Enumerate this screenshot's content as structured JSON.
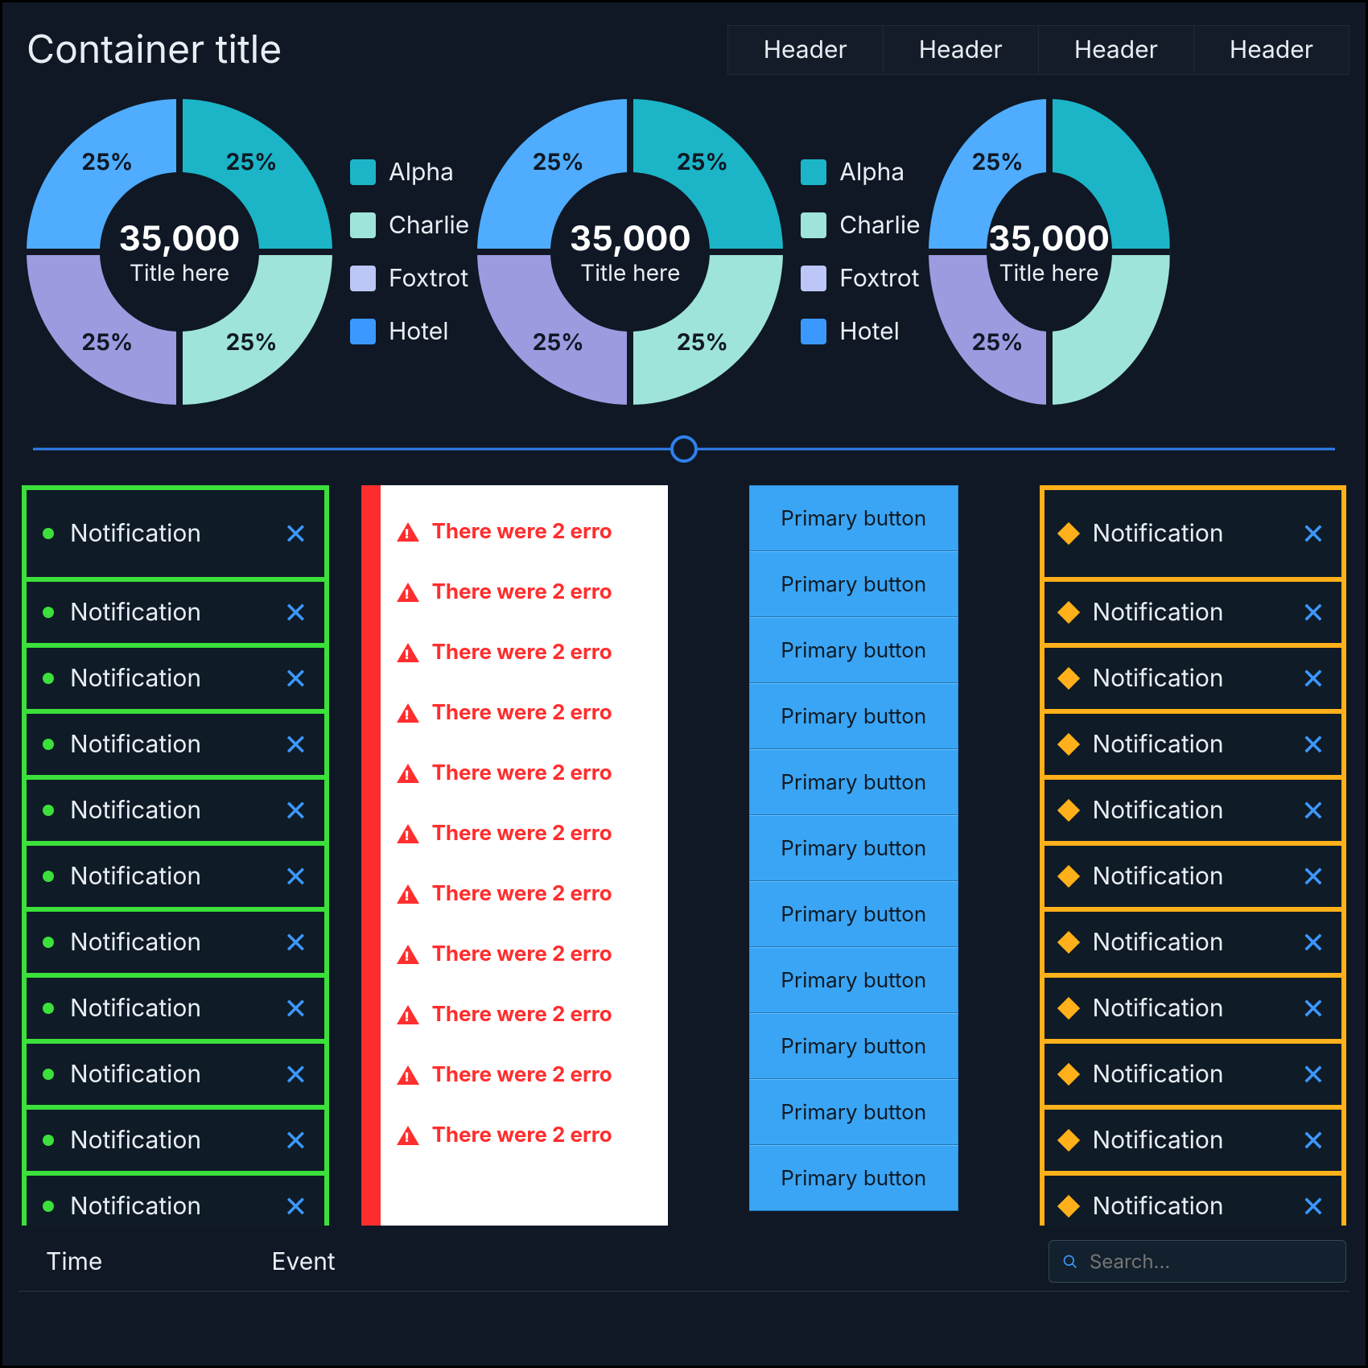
{
  "header": {
    "title": "Container title",
    "tabs": [
      "Header",
      "Header",
      "Header",
      "Header"
    ]
  },
  "donut": {
    "center_value": "35,000",
    "center_title": "Title here",
    "slice_label": "25%"
  },
  "legend": {
    "items": [
      {
        "label": "Alpha",
        "color": "#1BB5C7"
      },
      {
        "label": "Charlie",
        "color": "#9FE4DA"
      },
      {
        "label": "Foxtrot",
        "color": "#BCC6F7"
      },
      {
        "label": "Hotel",
        "color": "#3B98FF"
      }
    ]
  },
  "notification_label": "Notification",
  "error_label": "There were 2 erro",
  "button_label": "Primary button",
  "footer": {
    "col_time": "Time",
    "col_event": "Event",
    "search_placeholder": "Search..."
  },
  "chart_data": [
    {
      "type": "pie",
      "title": "Title here",
      "total": 35000,
      "series": [
        {
          "name": "Alpha",
          "value": 25
        },
        {
          "name": "Charlie",
          "value": 25
        },
        {
          "name": "Foxtrot",
          "value": 25
        },
        {
          "name": "Hotel",
          "value": 25
        }
      ]
    },
    {
      "type": "pie",
      "title": "Title here",
      "total": 35000,
      "series": [
        {
          "name": "Alpha",
          "value": 25
        },
        {
          "name": "Charlie",
          "value": 25
        },
        {
          "name": "Foxtrot",
          "value": 25
        },
        {
          "name": "Hotel",
          "value": 25
        }
      ]
    },
    {
      "type": "pie",
      "title": "Title here",
      "total": 35000,
      "series": [
        {
          "name": "Alpha",
          "value": 25
        },
        {
          "name": "Charlie",
          "value": 25
        },
        {
          "name": "Foxtrot",
          "value": 25
        },
        {
          "name": "Hotel",
          "value": 25
        }
      ]
    }
  ]
}
